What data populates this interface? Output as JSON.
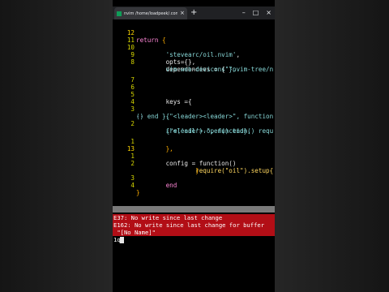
{
  "browser": {
    "tab_title": "nvim /home/loadpeek/.config",
    "close_glyph": "×",
    "new_tab_glyph": "+",
    "win_minimize": "–",
    "win_maximize": "□",
    "win_close": "×"
  },
  "editor": {
    "lines": [
      {
        "num": "12",
        "current": true
      },
      {
        "num": "11"
      },
      {
        "num": "10"
      },
      {
        "num": "9"
      },
      {
        "num": "8"
      },
      {
        "num": "7"
      },
      {
        "num": "6"
      },
      {
        "num": "5"
      },
      {
        "num": "4"
      },
      {
        "num": "3"
      },
      {
        "num": ""
      },
      {
        "num": "2"
      },
      {
        "num": ""
      },
      {
        "num": "1"
      },
      {
        "num": "13",
        "current": true
      },
      {
        "num": "1"
      },
      {
        "num": "2"
      },
      {
        "num": ""
      },
      {
        "num": "3"
      },
      {
        "num": "4"
      }
    ],
    "text": {
      "return": "return",
      "open_brace": "{",
      "plugin": "'stevearc/oil.nvim'",
      "comma": ",",
      "opts": "opts={},",
      "dependencies": "dependencies = {",
      "dep_nvimtree": "\"nvim-tree/n",
      "dep_web": "vim-web-devicons\"},",
      "keys": "keys ={",
      "comment": "--",
      "key1": "{\"<leader><leader>\", function",
      "key1_cont": "() end },",
      "key2": "{\"<leader>-\", function() requ",
      "key2_cont": "ire('oil').open() end},",
      "close_tbl": "},",
      "config": "config = function()",
      "require": "require(\"oil\").setup{",
      "close_setup": "}",
      "end": "end",
      "close_all": "}"
    }
  },
  "messages": {
    "err1": "E37: No write since last change",
    "err2": "E162: No write since last change for buffer",
    "err2_cont": " \"[No Name]\"",
    "prompt": "1q"
  },
  "colors": {
    "error_bg": "#b20e16",
    "line_number": "#d7d700",
    "keyword": "#ff87d7",
    "string": "#87d7d7"
  }
}
